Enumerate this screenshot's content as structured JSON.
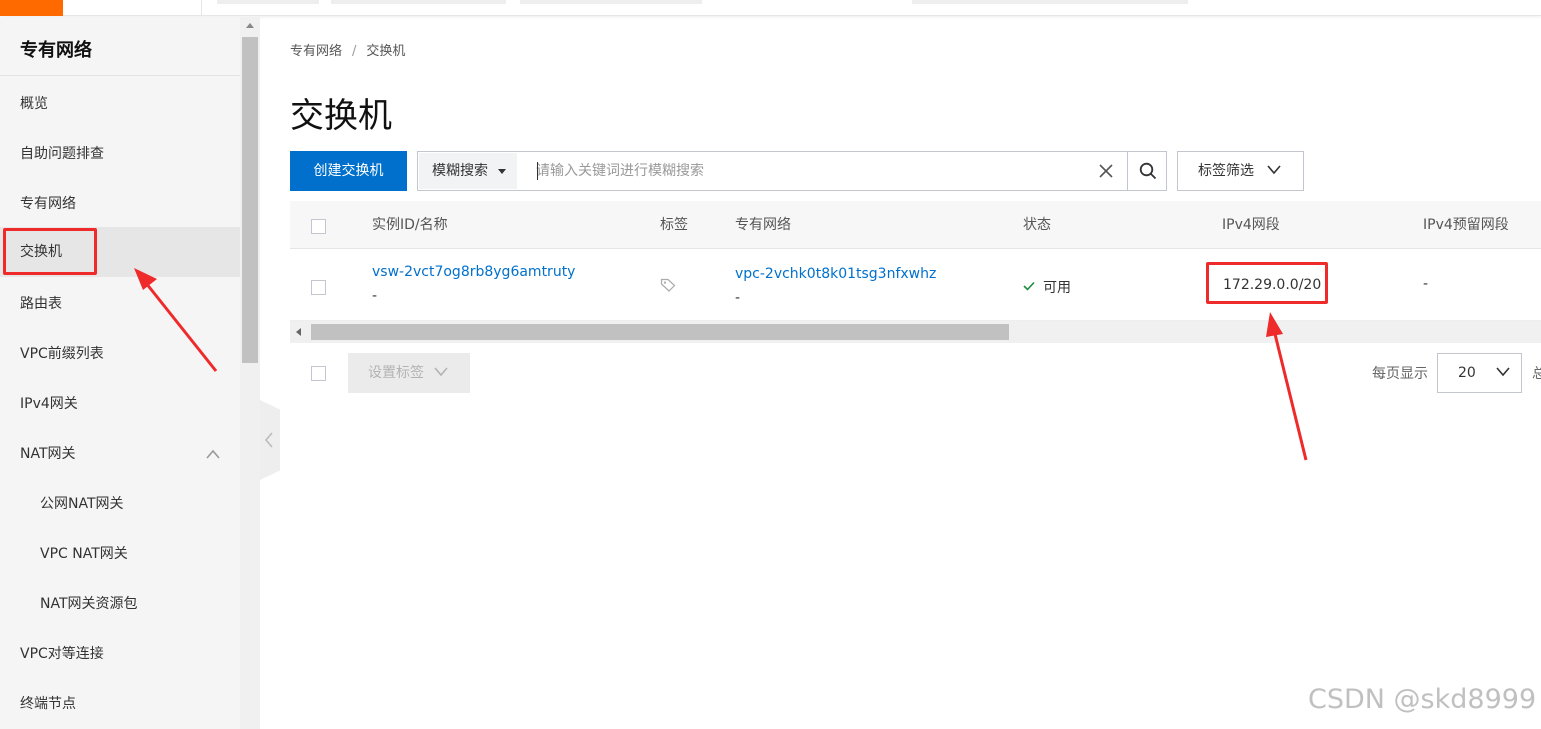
{
  "sidebar": {
    "title": "专有网络",
    "items": [
      {
        "label": "概览"
      },
      {
        "label": "自助问题排查"
      },
      {
        "label": "专有网络"
      },
      {
        "label": "交换机"
      },
      {
        "label": "路由表"
      },
      {
        "label": "VPC前缀列表"
      },
      {
        "label": "IPv4网关"
      },
      {
        "label": "NAT网关",
        "expanded": true
      },
      {
        "label": "公网NAT网关"
      },
      {
        "label": "VPC NAT网关"
      },
      {
        "label": "NAT网关资源包"
      },
      {
        "label": "VPC对等连接"
      },
      {
        "label": "终端节点"
      }
    ],
    "active_item": "交换机"
  },
  "breadcrumb": {
    "root": "专有网络",
    "separator": "/",
    "current": "交换机"
  },
  "page": {
    "title": "交换机"
  },
  "toolbar": {
    "create_label": "创建交换机",
    "search_mode": "模糊搜索",
    "search_placeholder": "请输入关键词进行模糊搜索",
    "search_value": "",
    "tag_filter_label": "标签筛选"
  },
  "table": {
    "columns": [
      "实例ID/名称",
      "标签",
      "专有网络",
      "状态",
      "IPv4网段",
      "IPv4预留网段"
    ],
    "rows": [
      {
        "instance_id": "vsw-2vct7og8rb8yg6amtruty",
        "instance_name": "-",
        "vpc_id": "vpc-2vchk0t8k01tsg3nfxwhz",
        "vpc_name": "-",
        "status": "可用",
        "ipv4_cidr": "172.29.0.0/20",
        "ipv4_reserved": "-"
      }
    ]
  },
  "footer": {
    "set_tags_label": "设置标签",
    "page_size_label": "每页显示",
    "page_size": "20",
    "total_prefix": "总"
  },
  "watermark": "CSDN @skd8999",
  "colors": {
    "brand_orange": "#ff6a00",
    "primary_blue": "#0070cc",
    "highlight_red": "#ee2a2a",
    "status_green": "#1e8e3e"
  }
}
